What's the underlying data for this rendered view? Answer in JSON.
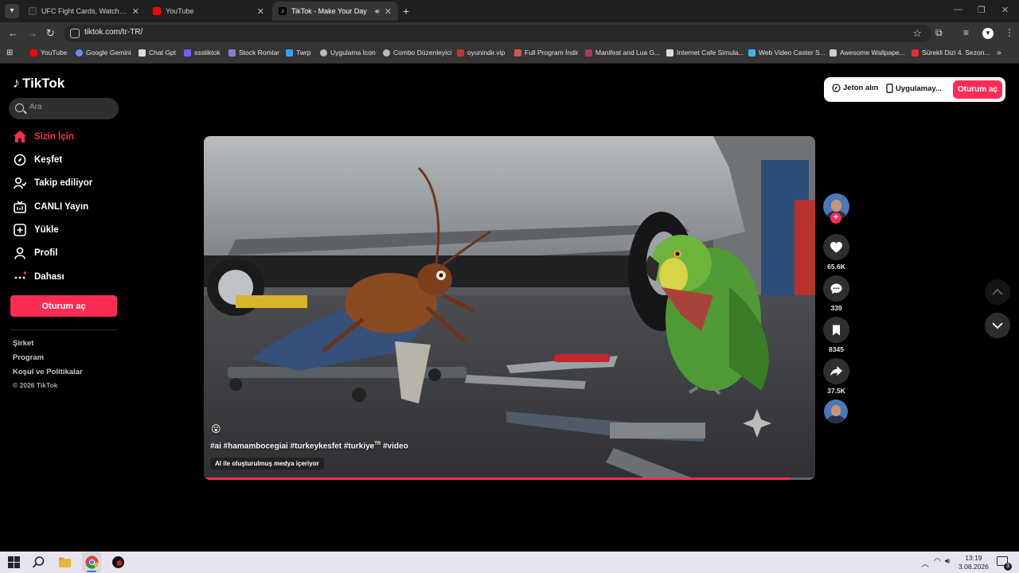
{
  "browser": {
    "tabs": [
      {
        "title": "UFC Fight Cards, Watch Times, I",
        "active": false
      },
      {
        "title": "YouTube",
        "active": false
      },
      {
        "title": "TikTok - Make Your Day",
        "active": true
      }
    ],
    "url": "tiktok.com/tr-TR/",
    "bookmarks": [
      "YouTube",
      "Google Gemini",
      "Chat Gpt",
      "ssstiktok",
      "Stock Romlar",
      "Twrp",
      "Uygulama İcon",
      "Combo Düzenleyici",
      "oyunindir.vip",
      "Full Program İndir",
      "Manifest and Lua G...",
      "Internet Cafe Simula...",
      "Web Video Caster S...",
      "Awesome Wallpape...",
      "Sürekli Dizi 4. Sezon..."
    ],
    "bookmarks_more": "»"
  },
  "tiktok": {
    "logo_text": "TikTok",
    "search_placeholder": "Ara",
    "nav": [
      {
        "label": "Sizin İçin",
        "icon": "home-icon",
        "active": true
      },
      {
        "label": "Keşfet",
        "icon": "compass-icon",
        "active": false
      },
      {
        "label": "Takip ediliyor",
        "icon": "following-icon",
        "active": false
      },
      {
        "label": "CANLI Yayın",
        "icon": "live-icon",
        "active": false
      },
      {
        "label": "Yükle",
        "icon": "upload-icon",
        "active": false
      },
      {
        "label": "Profil",
        "icon": "profile-icon",
        "active": false
      },
      {
        "label": "Dahası",
        "icon": "more-icon",
        "active": false
      }
    ],
    "login_label": "Oturum aç",
    "footer_links": [
      "Şirket",
      "Program",
      "Koşul ve Politikalar"
    ],
    "copyright": "© 2026 TikTok",
    "top_right": {
      "coins_label": "Jeton alın",
      "app_label": "Uygulamay...",
      "login_label": "Oturum aç"
    },
    "video": {
      "emoji": "😮",
      "tags_main": "#ai #hamambocegiai #turkeykesfet #turkiye",
      "tags_sup": "TR",
      "tags_end": " #video",
      "ai_notice": "AI ile oluşturulmuş medya içeriyor",
      "progress": 0.96
    },
    "actions": {
      "likes": "65.6K",
      "comments": "339",
      "saves": "8345",
      "shares": "37.5K"
    }
  },
  "taskbar": {
    "time": "13:19",
    "date": "3.08.2026",
    "notification_count": "3"
  },
  "colors": {
    "accent": "#fe2c55",
    "page_bg": "#000000"
  }
}
